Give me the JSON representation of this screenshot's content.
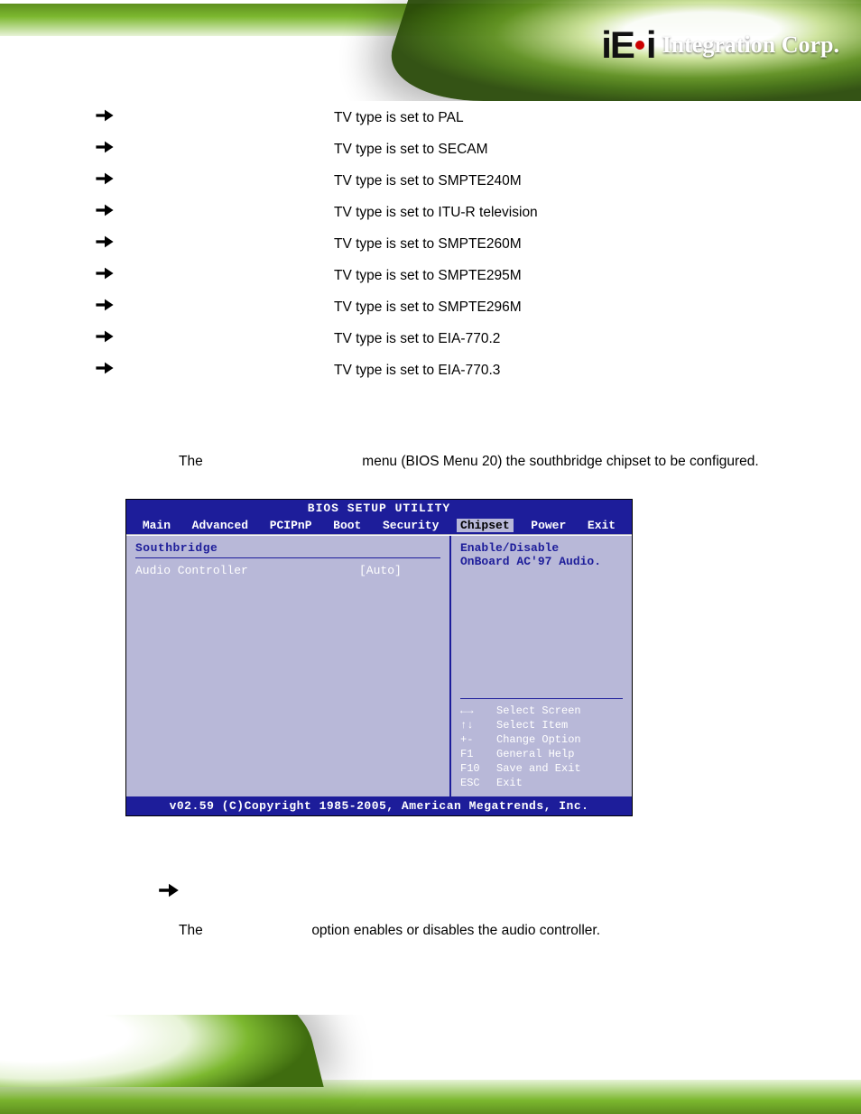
{
  "header": {
    "logo_prefix": "iE",
    "logo_suffix": "i",
    "logo_text": "Integration Corp."
  },
  "tv_types": [
    "TV type is set to PAL",
    "TV type is set to SECAM",
    "TV type is set to SMPTE240M",
    "TV type is set to ITU-R television",
    "TV type is set to SMPTE260M",
    "TV type is set to SMPTE295M",
    "TV type is set to SMPTE296M",
    "TV type is set to EIA-770.2",
    "TV type is set to EIA-770.3"
  ],
  "paragraph1_pre": "The",
  "paragraph1_post": "menu (BIOS Menu 20) the southbridge chipset to be configured.",
  "bios": {
    "title": "BIOS SETUP UTILITY",
    "tabs": [
      "Main",
      "Advanced",
      "PCIPnP",
      "Boot",
      "Security",
      "Chipset",
      "Power",
      "Exit"
    ],
    "selected_tab": "Chipset",
    "group": "Southbridge",
    "setting_label": "Audio Controller",
    "setting_value": "[Auto]",
    "help_line1": "Enable/Disable",
    "help_line2": "OnBoard AC'97 Audio.",
    "keys": [
      {
        "k": "←→",
        "d": "Select Screen"
      },
      {
        "k": "↑↓",
        "d": "Select Item"
      },
      {
        "k": "+-",
        "d": "Change Option"
      },
      {
        "k": "F1",
        "d": "General Help"
      },
      {
        "k": "F10",
        "d": "Save and Exit"
      },
      {
        "k": "ESC",
        "d": "Exit"
      }
    ],
    "footer": "v02.59 (C)Copyright 1985-2005, American Megatrends, Inc."
  },
  "paragraph2_pre": "The",
  "paragraph2_post": "option enables or disables the audio controller."
}
